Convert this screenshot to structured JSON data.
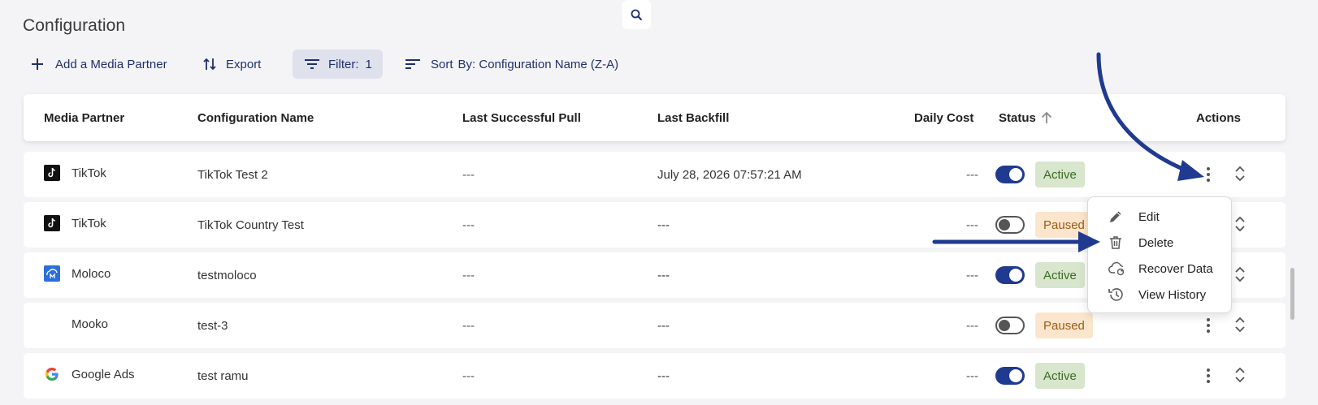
{
  "page": {
    "title": "Configuration"
  },
  "toolbar": {
    "add_label": "Add a Media Partner",
    "export_label": "Export",
    "filter_label": "Filter:",
    "filter_count": "1",
    "sort_prefix": "Sort",
    "sort_value": "By: Configuration Name (Z-A)"
  },
  "table": {
    "headers": {
      "media_partner": "Media Partner",
      "configuration_name": "Configuration Name",
      "last_successful_pull": "Last Successful Pull",
      "last_backfill": "Last Backfill",
      "daily_cost": "Daily Cost",
      "status": "Status",
      "actions": "Actions"
    },
    "rows": [
      {
        "partner": "TikTok",
        "logo": "tiktok-logo",
        "config": "TikTok Test 2",
        "last_pull": "---",
        "last_backfill": "July 28, 2026 07:57:21 AM",
        "daily_cost": "---",
        "enabled": true,
        "status": "Active"
      },
      {
        "partner": "TikTok",
        "logo": "tiktok-logo",
        "config": "TikTok Country Test",
        "last_pull": "---",
        "last_backfill": "---",
        "daily_cost": "---",
        "enabled": false,
        "status": "Paused"
      },
      {
        "partner": "Moloco",
        "logo": "moloco-logo",
        "config": "testmoloco",
        "last_pull": "---",
        "last_backfill": "---",
        "daily_cost": "---",
        "enabled": true,
        "status": "Active"
      },
      {
        "partner": "Mooko",
        "logo": "",
        "config": "test-3",
        "last_pull": "---",
        "last_backfill": "---",
        "daily_cost": "---",
        "enabled": false,
        "status": "Paused"
      },
      {
        "partner": "Google Ads",
        "logo": "google-logo",
        "config": "test ramu",
        "last_pull": "---",
        "last_backfill": "---",
        "daily_cost": "---",
        "enabled": true,
        "status": "Active"
      }
    ]
  },
  "actions_menu": {
    "items": [
      {
        "label": "Edit",
        "icon": "pencil-icon"
      },
      {
        "label": "Delete",
        "icon": "trash-icon"
      },
      {
        "label": "Recover Data",
        "icon": "cloud-refresh-icon"
      },
      {
        "label": "View History",
        "icon": "history-icon"
      }
    ]
  },
  "colors": {
    "accent": "#1f3a8f",
    "active_badge_bg": "#d7e6cc",
    "paused_badge_bg": "#fbe6cd",
    "annotation_arrow": "#1f3a8f"
  }
}
